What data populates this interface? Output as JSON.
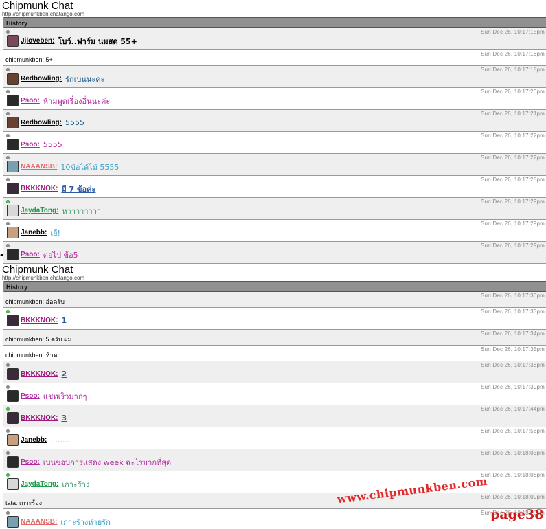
{
  "window": {
    "title": "Chipmunk Chat",
    "url": "http://chipmunkben.chatango.com",
    "history_label": "History"
  },
  "colors": {
    "Jjloveben": "#000000",
    "Redbowling": "#000000",
    "Psoo": "#b0279f",
    "NAAANSB": "#e06a6a",
    "BKKKNOK": "#9b1a7a",
    "JaydaTong": "#1d9a4a",
    "Janebb": "#000000",
    "text_Redbowling": "#1a5a8a",
    "text_Psoo": "#b0279f",
    "text_NAAANSB": "#3aa0c8",
    "text_BKKKNOK": "#2a5aa0",
    "text_JaydaTong": "#3a9a6a",
    "text_Janebb": "#3aa0c8"
  },
  "panel1": {
    "messages": [
      {
        "type": "user",
        "user": "Jjloveben:",
        "key": "Jjloveben",
        "text": "โบว์..ฟาร์ม นมสด 55+",
        "time": "Sun Dec 26, 10:17:15pm",
        "online": false,
        "avatar": "#7a4a5a",
        "bold": true
      },
      {
        "type": "plain",
        "text": "chipmunkben: 5+",
        "time": "Sun Dec 26, 10:17:16pm"
      },
      {
        "type": "user",
        "user": "Redbowling:",
        "key": "Redbowling",
        "text": "รักเบนนะคะ",
        "time": "Sun Dec 26, 10:17:18pm",
        "online": false,
        "avatar": "#6a4030"
      },
      {
        "type": "user",
        "user": "Psoo:",
        "key": "Psoo",
        "text": "ห้ามพูดเรื่องอื่นนะค่ะ",
        "time": "Sun Dec 26, 10:17:20pm",
        "online": false,
        "avatar": "#2a2a2a"
      },
      {
        "type": "user",
        "user": "Redbowling:",
        "key": "Redbowling",
        "text": "5555",
        "time": "Sun Dec 26, 10:17:21pm",
        "online": false,
        "avatar": "#6a4030"
      },
      {
        "type": "user",
        "user": "Psoo:",
        "key": "Psoo",
        "text": "5555",
        "time": "Sun Dec 26, 10:17:22pm",
        "online": false,
        "avatar": "#2a2a2a"
      },
      {
        "type": "user",
        "user": "NAAANSB:",
        "key": "NAAANSB",
        "text": "10ข้อได้ไม้ 5555",
        "time": "Sun Dec 26, 10:17:22pm",
        "online": false,
        "avatar": "#7aa0b0"
      },
      {
        "type": "user",
        "user": "BKKKNOK:",
        "key": "BKKKNOK",
        "text": "มี 7 ข้อค่ะ",
        "time": "Sun Dec 26, 10:17:25pm",
        "online": false,
        "avatar": "#3a2a3a",
        "underline": true
      },
      {
        "type": "user",
        "user": "JaydaTong:",
        "key": "JaydaTong",
        "text": "หาาาาาาาา",
        "time": "Sun Dec 26, 10:17:29pm",
        "online": true,
        "avatar": "#d8d8d8"
      },
      {
        "type": "user",
        "user": "Janebb:",
        "key": "Janebb",
        "text": "เย้!",
        "time": "Sun Dec 26, 10:17:29pm",
        "online": false,
        "avatar": "#c8a080"
      },
      {
        "type": "user",
        "user": "Psoo:",
        "key": "Psoo",
        "text": "ต่อไป ข้อ5",
        "time": "Sun Dec 26, 10:17:29pm",
        "online": false,
        "avatar": "#2a2a2a"
      }
    ]
  },
  "panel2": {
    "messages": [
      {
        "type": "plain",
        "text": "chipmunkben: อ๋อครับ",
        "time": "Sun Dec 26, 10:17:30pm"
      },
      {
        "type": "user",
        "user": "BKKKNOK:",
        "key": "BKKKNOK",
        "text": "1",
        "time": "Sun Dec 26, 10:17:33pm",
        "online": true,
        "avatar": "#3a2a3a",
        "underline": true
      },
      {
        "type": "plain",
        "text": "chipmunkben: 5 ครับ ผม",
        "time": "Sun Dec 26, 10:17:34pm"
      },
      {
        "type": "plain",
        "text": "chipmunkben: ห้าหา",
        "time": "Sun Dec 26, 10:17:35pm"
      },
      {
        "type": "user",
        "user": "BKKKNOK:",
        "key": "BKKKNOK",
        "text": "2",
        "time": "Sun Dec 26, 10:17:38pm",
        "online": false,
        "avatar": "#3a2a3a",
        "underline": true
      },
      {
        "type": "user",
        "user": "Psoo:",
        "key": "Psoo",
        "text": "แชทเร็วมากๆ",
        "time": "Sun Dec 26, 10:17:39pm",
        "online": false,
        "avatar": "#2a2a2a"
      },
      {
        "type": "user",
        "user": "BKKKNOK:",
        "key": "BKKKNOK",
        "text": "3",
        "time": "Sun Dec 26, 10:17:44pm",
        "online": true,
        "avatar": "#3a2a3a",
        "underline": true
      },
      {
        "type": "user",
        "user": "Janebb:",
        "key": "Janebb",
        "text": "........",
        "time": "Sun Dec 26, 10:17:58pm",
        "online": false,
        "avatar": "#c8a080"
      },
      {
        "type": "user",
        "user": "Psoo:",
        "key": "Psoo",
        "text": "เบนชอบการแสดง week ฉะไรมากที่สุด",
        "time": "Sun Dec 26, 10:18:03pm",
        "online": false,
        "avatar": "#2a2a2a"
      },
      {
        "type": "user",
        "user": "JaydaTong:",
        "key": "JaydaTong",
        "text": "เกาะร้าง",
        "time": "Sun Dec 26, 10:18:08pm",
        "online": true,
        "avatar": "#d8d8d8"
      },
      {
        "type": "plain",
        "text": "tata: เกาะร้อง",
        "time": "Sun Dec 26, 10:18:09pm"
      },
      {
        "type": "user",
        "user": "NAAANSB:",
        "key": "NAAANSB",
        "text": "เกาะร้างห่ายรัก",
        "time": "Sun Dec 26, 10:18:10pm",
        "online": false,
        "avatar": "#7aa0b0"
      }
    ]
  },
  "watermark": {
    "site": "www.chipmunkben.com",
    "page": "page38"
  }
}
